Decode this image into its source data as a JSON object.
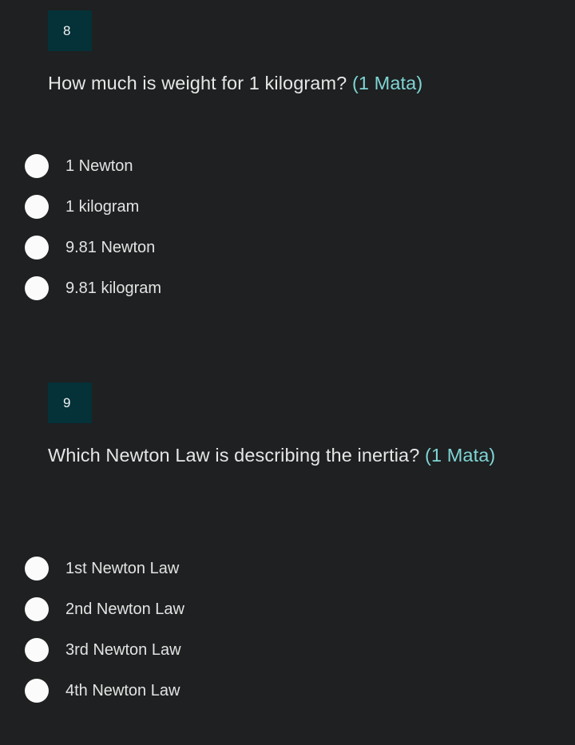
{
  "theme": {
    "background_color": "#1e2021",
    "badge_background_color": "#053139",
    "badge_text_color": "#f2f4f4",
    "question_text_color": "#e6e6e6",
    "points_text_color": "#7fd4d4",
    "option_text_color": "#e3e3e3",
    "radio_fill_color": "#fbfbfb"
  },
  "questions": [
    {
      "number": "8",
      "prompt": "How much is weight for 1 kilogram? ",
      "points_label": "(1 Mata)",
      "options": [
        {
          "label": "1 Newton",
          "selected": false
        },
        {
          "label": "1 kilogram",
          "selected": false
        },
        {
          "label": "9.81 Newton",
          "selected": false
        },
        {
          "label": "9.81 kilogram",
          "selected": false
        }
      ]
    },
    {
      "number": "9",
      "prompt": "Which Newton Law is describing the inertia? ",
      "points_label": "(1 Mata)",
      "options": [
        {
          "label": "1st Newton Law",
          "selected": false
        },
        {
          "label": "2nd Newton Law",
          "selected": false
        },
        {
          "label": "3rd Newton Law",
          "selected": false
        },
        {
          "label": "4th Newton Law",
          "selected": false
        }
      ]
    }
  ]
}
